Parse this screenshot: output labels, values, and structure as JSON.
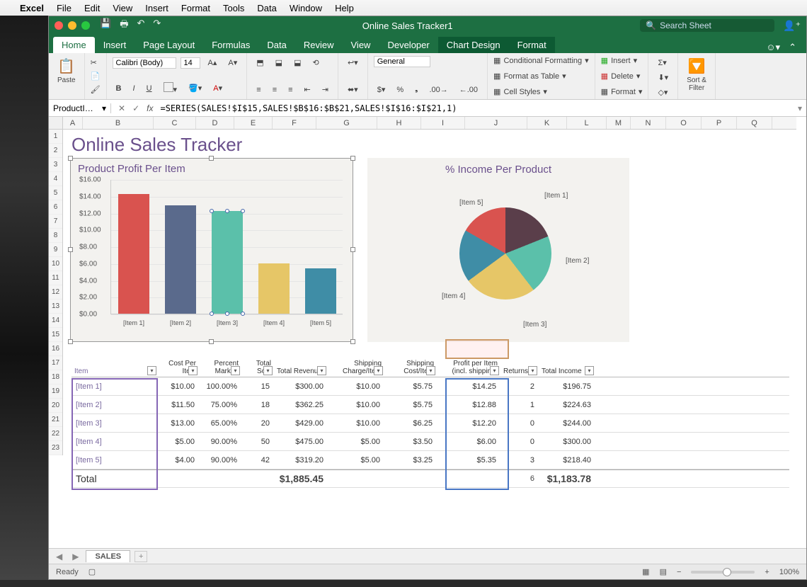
{
  "mac_menu": {
    "app": "Excel",
    "items": [
      "File",
      "Edit",
      "View",
      "Insert",
      "Format",
      "Tools",
      "Data",
      "Window",
      "Help"
    ]
  },
  "window": {
    "title": "Online Sales Tracker1",
    "search_placeholder": "Search Sheet"
  },
  "tabs": {
    "items": [
      "Home",
      "Insert",
      "Page Layout",
      "Formulas",
      "Data",
      "Review",
      "View",
      "Developer",
      "Chart Design",
      "Format"
    ],
    "active": "Home"
  },
  "ribbon": {
    "paste": "Paste",
    "font_name": "Calibri (Body)",
    "font_size": "14",
    "number_format": "General",
    "cond_fmt": "Conditional Formatting",
    "fmt_table": "Format as Table",
    "cell_styles": "Cell Styles",
    "insert": "Insert",
    "delete": "Delete",
    "format": "Format",
    "sort_filter": "Sort &\nFilter"
  },
  "formula_bar": {
    "name": "ProductI…",
    "formula": "=SERIES(SALES!$I$15,SALES!$B$16:$B$21,SALES!$I$16:$I$21,1)"
  },
  "columns": [
    "A",
    "B",
    "C",
    "D",
    "E",
    "F",
    "G",
    "H",
    "I",
    "J",
    "K",
    "L",
    "M",
    "N",
    "O",
    "P",
    "Q"
  ],
  "sheet": {
    "title": "Online Sales Tracker",
    "chart1_title": "Product Profit Per Item",
    "chart2_title": "% Income Per Product",
    "headers": [
      "Item",
      "Cost Per Item",
      "Percent Markup",
      "Total Sold",
      "Total Revenue",
      "Shipping Charge/Item",
      "Shipping Cost/Item",
      "Profit per Item (incl. shipping)",
      "Returns",
      "Total Income"
    ],
    "rows": [
      {
        "item": "[Item 1]",
        "cost": "$10.00",
        "markup": "100.00%",
        "sold": "15",
        "rev": "$300.00",
        "scharge": "$10.00",
        "scost": "$5.75",
        "profit": "$14.25",
        "ret": "2",
        "inc": "$196.75"
      },
      {
        "item": "[Item 2]",
        "cost": "$11.50",
        "markup": "75.00%",
        "sold": "18",
        "rev": "$362.25",
        "scharge": "$10.00",
        "scost": "$5.75",
        "profit": "$12.88",
        "ret": "1",
        "inc": "$224.63"
      },
      {
        "item": "[Item 3]",
        "cost": "$13.00",
        "markup": "65.00%",
        "sold": "20",
        "rev": "$429.00",
        "scharge": "$10.00",
        "scost": "$6.25",
        "profit": "$12.20",
        "ret": "0",
        "inc": "$244.00"
      },
      {
        "item": "[Item 4]",
        "cost": "$5.00",
        "markup": "90.00%",
        "sold": "50",
        "rev": "$475.00",
        "scharge": "$5.00",
        "scost": "$3.50",
        "profit": "$6.00",
        "ret": "0",
        "inc": "$300.00"
      },
      {
        "item": "[Item 5]",
        "cost": "$4.00",
        "markup": "90.00%",
        "sold": "42",
        "rev": "$319.20",
        "scharge": "$5.00",
        "scost": "$3.25",
        "profit": "$5.35",
        "ret": "3",
        "inc": "$218.40"
      }
    ],
    "total": {
      "label": "Total",
      "rev": "$1,885.45",
      "ret": "6",
      "inc": "$1,183.78"
    }
  },
  "chart_data": [
    {
      "type": "bar",
      "title": "Product Profit Per Item",
      "categories": [
        "[Item 1]",
        "[Item 2]",
        "[Item 3]",
        "[Item 4]",
        "[Item 5]"
      ],
      "values": [
        14.25,
        12.88,
        12.2,
        6.0,
        5.35
      ],
      "ylim": [
        0,
        16
      ],
      "ytick": 2,
      "yformat": "$0.00",
      "colors": [
        "#d9534f",
        "#5a6a8c",
        "#5bc0aa",
        "#e6c667",
        "#3f8da6"
      ]
    },
    {
      "type": "pie",
      "title": "% Income Per Product",
      "categories": [
        "[Item 1]",
        "[Item 2]",
        "[Item 3]",
        "[Item 4]",
        "[Item 5]"
      ],
      "values": [
        196.75,
        224.63,
        244.0,
        300.0,
        218.4
      ],
      "colors": [
        "#d9534f",
        "#5a3e4a",
        "#5bc0aa",
        "#e6c667",
        "#3f8da6"
      ]
    }
  ],
  "sheet_tabs": {
    "active": "SALES"
  },
  "status": {
    "text": "Ready",
    "zoom": "100%"
  }
}
